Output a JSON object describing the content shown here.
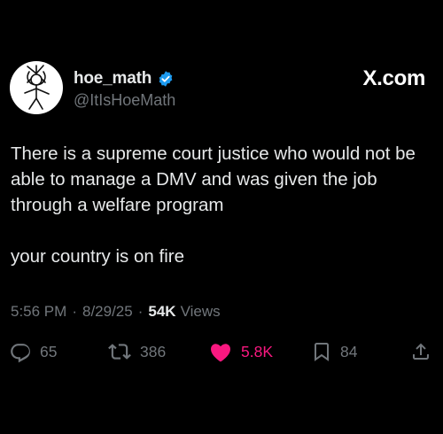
{
  "user": {
    "display_name": "hoe_math",
    "handle": "@ItIsHoeMath",
    "verified": true,
    "avatar": "line-drawing-avatar"
  },
  "site_mark": "X.com",
  "tweet": {
    "paragraphs": [
      "There is a supreme court justice who would not be able to manage a DMV and was given the job through a welfare program",
      "your country is on fire"
    ],
    "time": "5:56 PM",
    "date": "8/29/25",
    "views_count": "54K",
    "views_label": "Views"
  },
  "actions": {
    "reply": {
      "icon": "reply-icon",
      "count": "65"
    },
    "retweet": {
      "icon": "retweet-icon",
      "count": "386"
    },
    "like": {
      "icon": "heart-icon",
      "count": "5.8K",
      "liked": true
    },
    "bookmark": {
      "icon": "bookmark-icon",
      "count": "84"
    },
    "share": {
      "icon": "share-icon"
    }
  },
  "colors": {
    "background": "#000000",
    "text": "#e7e9ea",
    "secondary": "#71767b",
    "verified": "#1d9bf0",
    "like": "#f91880"
  }
}
